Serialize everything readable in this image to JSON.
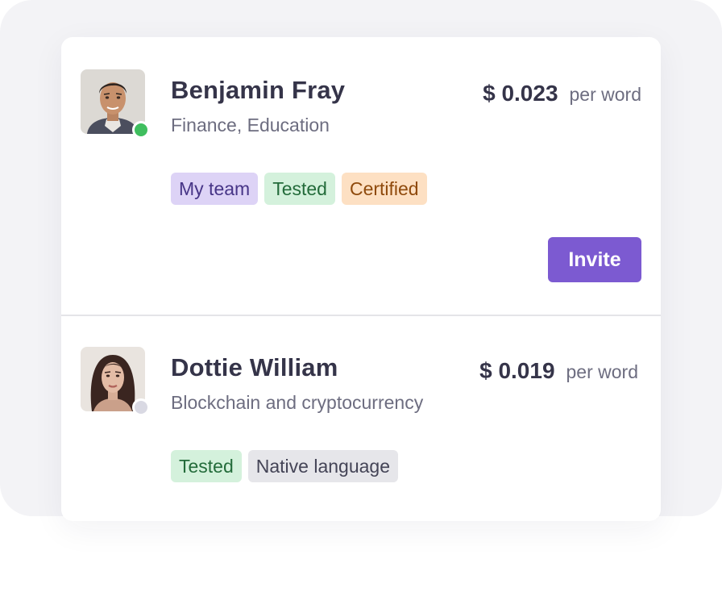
{
  "colors": {
    "background": "#f3f3f6",
    "card": "#ffffff",
    "accent": "#7c5ad1",
    "online": "#3fbe5e",
    "offline": "#d9d9e3"
  },
  "tag_styles": {
    "purple": {
      "bg": "#ddd3f6",
      "fg": "#473587"
    },
    "green": {
      "bg": "#d4f1dc",
      "fg": "#236b3a"
    },
    "orange": {
      "bg": "#fde0c3",
      "fg": "#8f4a0c"
    },
    "gray": {
      "bg": "#e6e6ea",
      "fg": "#444456"
    }
  },
  "translators": [
    {
      "name": "Benjamin Fray",
      "specialties": "Finance, Education",
      "price": "$ 0.023",
      "price_unit": "per word",
      "status": "online",
      "avatar_icon": "man-portrait",
      "tags": [
        {
          "label": "My team",
          "style": "purple"
        },
        {
          "label": "Tested",
          "style": "green"
        },
        {
          "label": "Certified",
          "style": "orange"
        }
      ],
      "invite_label": "Invite"
    },
    {
      "name": "Dottie William",
      "specialties": "Blockchain and cryptocurrency",
      "price": "$ 0.019",
      "price_unit": "per word",
      "status": "offline",
      "avatar_icon": "woman-portrait",
      "tags": [
        {
          "label": "Tested",
          "style": "green"
        },
        {
          "label": "Native language",
          "style": "gray"
        }
      ]
    }
  ]
}
